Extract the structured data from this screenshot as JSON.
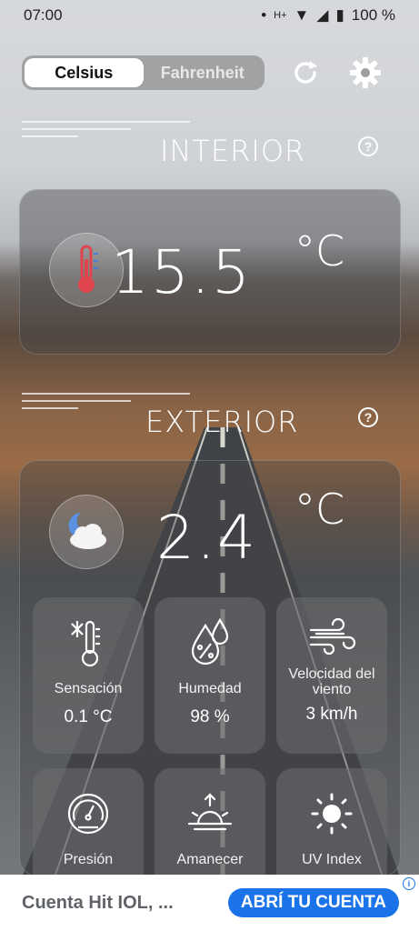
{
  "status_bar": {
    "time": "07:00",
    "battery": "100 %",
    "network": "H+"
  },
  "unit_toggle": {
    "celsius": "Celsius",
    "fahrenheit": "Fahrenheit",
    "selected": "Celsius"
  },
  "toolbar": {
    "refresh_icon": "refresh-icon",
    "settings_icon": "gear-icon"
  },
  "interior": {
    "title": "INTERIOR",
    "help": "?",
    "temperature": "15.5",
    "unit": "°C",
    "icon": "thermometer-icon"
  },
  "exterior": {
    "title": "EXTERIOR",
    "help": "?",
    "temperature": "2.4",
    "unit": "°C",
    "icon": "moon-cloud-icon"
  },
  "metrics": [
    {
      "label": "Sensación",
      "value": "0.1 °C",
      "icon": "snow-thermometer-icon"
    },
    {
      "label": "Humedad",
      "value": "98 %",
      "icon": "humidity-drops-icon"
    },
    {
      "label": "Velocidad del viento",
      "value": "3 km/h",
      "icon": "wind-icon"
    },
    {
      "label": "Presión",
      "value": "",
      "icon": "gauge-icon"
    },
    {
      "label": "Amanecer",
      "value": "",
      "icon": "sunrise-icon"
    },
    {
      "label": "UV Index",
      "value": "",
      "icon": "sun-icon"
    }
  ],
  "ad": {
    "text": "Cuenta Hit IOL, ...",
    "cta": "ABRÍ TU CUENTA",
    "info": "i"
  },
  "colors": {
    "accent": "#1a73e8",
    "thermometer_red": "#e0454d",
    "moon": "#5b8fe0"
  }
}
